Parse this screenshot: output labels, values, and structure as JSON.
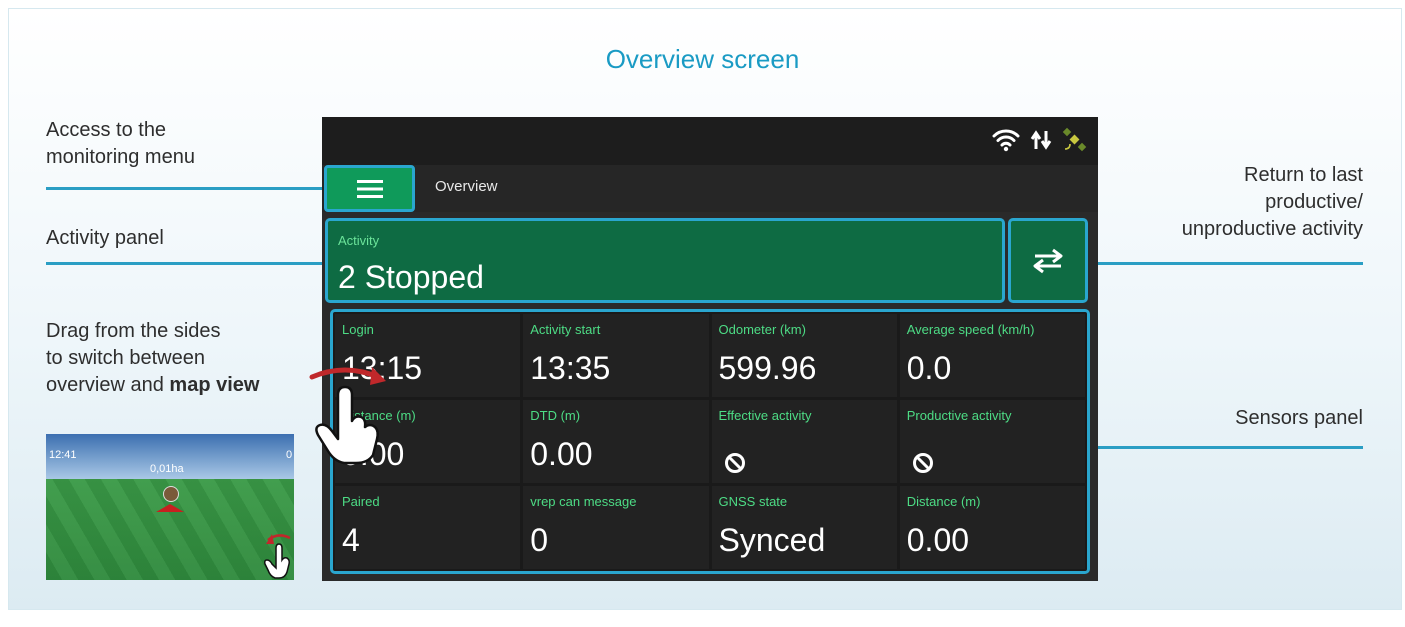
{
  "figure": {
    "title": "Overview screen"
  },
  "annotations": {
    "menu_access": "Access to the\nmonitoring menu",
    "activity_panel": "Activity panel",
    "drag_hint_line1": "Drag from the sides",
    "drag_hint_line2": "to switch between",
    "drag_hint_line3_prefix": "overview and ",
    "drag_hint_line3_bold": "map view",
    "return_last": "Return to last\nproductive/\nunproductive activity",
    "sensors_panel": "Sensors panel"
  },
  "device": {
    "status_icons": [
      "wifi-icon",
      "data-transfer-icon",
      "satellite-icon"
    ],
    "screen_title": "Overview",
    "activity": {
      "label": "Activity",
      "value": "2 Stopped"
    },
    "sensors": [
      {
        "label": "Login",
        "value": "13:15"
      },
      {
        "label": "Activity start",
        "value": "13:35"
      },
      {
        "label": "Odometer (km)",
        "value": "599.96"
      },
      {
        "label": "Average speed (km/h)",
        "value": "0.0"
      },
      {
        "label": "Distance (m)",
        "value": "0.00"
      },
      {
        "label": "DTD (m)",
        "value": "0.00"
      },
      {
        "label": "Effective activity",
        "value": "",
        "icon": "prohibited-icon"
      },
      {
        "label": "Productive activity",
        "value": "",
        "icon": "prohibited-icon"
      },
      {
        "label": "Paired",
        "value": "4"
      },
      {
        "label": "vrep can message",
        "value": "0"
      },
      {
        "label": "GNSS state",
        "value": "Synced"
      },
      {
        "label": "Distance (m)",
        "value": "0.00"
      }
    ]
  },
  "map_thumbnail": {
    "time": "12:41",
    "area": "0,01ha",
    "counter": "0"
  },
  "colors": {
    "accent": "#2aa6cf",
    "title": "#1a9bc4",
    "green_button": "#0f9a5a",
    "activity_bg": "#0e6b43",
    "sensor_label": "#4ddc85",
    "swipe_arrow": "#c0282b"
  }
}
